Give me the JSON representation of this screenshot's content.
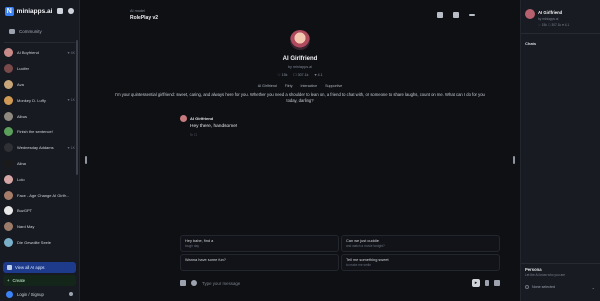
{
  "brand": {
    "name": "miniapps.ai"
  },
  "nav": {
    "community": "Community"
  },
  "chats": [
    {
      "name": "AI Boyfriend",
      "meta": "♥ 4K",
      "color": "#c98a8a"
    },
    {
      "name": "Lucifer",
      "meta": "",
      "color": "#7a4a4a"
    },
    {
      "name": "Ava",
      "meta": "",
      "color": "#c9a57a"
    },
    {
      "name": "Monkey D. Luffy",
      "meta": "♥ 1K",
      "color": "#d19a54"
    },
    {
      "name": "Albus",
      "meta": "",
      "color": "#8f8a80"
    },
    {
      "name": "Finish the sentence!",
      "meta": "",
      "color": "#5aa05a"
    },
    {
      "name": "Wednesday Addams",
      "meta": "♥ 1K",
      "color": "#2f2f36"
    },
    {
      "name": "Alina",
      "meta": "",
      "color": "#1a1a1a"
    },
    {
      "name": "Lolo",
      "meta": "",
      "color": "#d6a5a5"
    },
    {
      "name": "Face - Age Change AI Girlfr...",
      "meta": "",
      "color": "#a77d6a"
    },
    {
      "name": "BuzGPT",
      "meta": "",
      "color": "#e8e8e8"
    },
    {
      "name": "Nard May",
      "meta": "",
      "color": "#9b7a6a"
    },
    {
      "name": "Die Gewollte Seele",
      "meta": "",
      "color": "#7ab0c9"
    }
  ],
  "sidebar": {
    "view_all": "View all AI apps",
    "create": "Create",
    "login": "Login / Signup"
  },
  "topbar": {
    "model_label": "AI model",
    "model_name": "RolePlay v2"
  },
  "bot": {
    "title": "AI Girlfriend",
    "by": "by miniapps.ai",
    "stats": [
      "♡ 15k",
      "☐ 307.1k",
      "♥ 4.1"
    ],
    "tags": [
      "AI Girlfriend",
      "Flirty",
      "Interactive",
      "Supportive"
    ],
    "description": "I'm your quintessential girlfriend: sweet, caring, and always here for you. Whether you need a shoulder to lean on, a friend to chat with, or someone to share laughs, count on me. What can I do for you today, darling?"
  },
  "message": {
    "sender": "AI Girlfriend",
    "text": "Hey there, handsome!",
    "actions": "↻ ☐"
  },
  "suggestions": [
    {
      "title": "Hey babe, find a",
      "sub": "tough day"
    },
    {
      "title": "Can we just cuddle",
      "sub": "and watch a movie tonight?"
    },
    {
      "title": "Wanna have some fun?",
      "sub": ""
    },
    {
      "title": "Tell me something sweet",
      "sub": "to make me smile"
    }
  ],
  "composer": {
    "placeholder": "Type your message"
  },
  "right_panel": {
    "name": "AI Girlfriend",
    "by": "by miniapps.ai",
    "stats": "♡ 15k  ☐ 307.1k  ♥ 4.1",
    "chats_heading": "Chats",
    "persona_heading": "Persona",
    "persona_sub": "Let the AI know who you are",
    "persona_select": "None selected"
  }
}
